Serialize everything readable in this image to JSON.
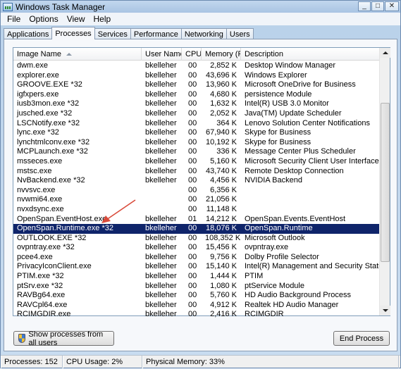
{
  "window": {
    "title": "Windows Task Manager",
    "controls": {
      "minimize": "_",
      "maximize": "□",
      "close": "✕"
    }
  },
  "menu": [
    "File",
    "Options",
    "View",
    "Help"
  ],
  "tabs": [
    "Applications",
    "Processes",
    "Services",
    "Performance",
    "Networking",
    "Users"
  ],
  "active_tab": "Processes",
  "columns": [
    "Image Name",
    "User Name",
    "CPU",
    "Memory (P...",
    "Description"
  ],
  "sort": {
    "column": "Image Name",
    "direction": "ascending"
  },
  "processes": [
    [
      "dwm.exe",
      "bkelleher",
      "00",
      "2,852 K",
      "Desktop Window Manager"
    ],
    [
      "explorer.exe",
      "bkelleher",
      "00",
      "43,696 K",
      "Windows Explorer"
    ],
    [
      "GROOVE.EXE *32",
      "bkelleher",
      "00",
      "13,960 K",
      "Microsoft OneDrive for Business"
    ],
    [
      "igfxpers.exe",
      "bkelleher",
      "00",
      "4,680 K",
      "persistence Module"
    ],
    [
      "iusb3mon.exe *32",
      "bkelleher",
      "00",
      "1,632 K",
      "Intel(R) USB 3.0 Monitor"
    ],
    [
      "jusched.exe *32",
      "bkelleher",
      "00",
      "2,052 K",
      "Java(TM) Update Scheduler"
    ],
    [
      "LSCNotify.exe *32",
      "bkelleher",
      "00",
      "364 K",
      "Lenovo Solution Center Notifications"
    ],
    [
      "lync.exe *32",
      "bkelleher",
      "00",
      "67,940 K",
      "Skype for Business"
    ],
    [
      "lynchtmlconv.exe *32",
      "bkelleher",
      "00",
      "10,192 K",
      "Skype for Business"
    ],
    [
      "MCPLaunch.exe *32",
      "bkelleher",
      "00",
      "336 K",
      "Message Center Plus Scheduler"
    ],
    [
      "msseces.exe",
      "bkelleher",
      "00",
      "5,160 K",
      "Microsoft Security Client User Interface"
    ],
    [
      "mstsc.exe",
      "bkelleher",
      "00",
      "43,740 K",
      "Remote Desktop Connection"
    ],
    [
      "NvBackend.exe *32",
      "bkelleher",
      "00",
      "4,456 K",
      "NVIDIA Backend"
    ],
    [
      "nvvsvc.exe",
      "",
      "00",
      "6,356 K",
      ""
    ],
    [
      "nvwmi64.exe",
      "",
      "00",
      "21,056 K",
      ""
    ],
    [
      "nvxdsync.exe",
      "",
      "00",
      "11,148 K",
      ""
    ],
    [
      "OpenSpan.EventHost.exe",
      "bkelleher",
      "01",
      "14,212 K",
      "OpenSpan.Events.EventHost"
    ],
    [
      "OpenSpan.Runtime.exe *32",
      "bkelleher",
      "00",
      "18,076 K",
      "OpenSpan.Runtime"
    ],
    [
      "OUTLOOK.EXE *32",
      "bkelleher",
      "00",
      "108,352 K",
      "Microsoft Outlook"
    ],
    [
      "ovpntray.exe *32",
      "bkelleher",
      "00",
      "15,456 K",
      "ovpntray.exe"
    ],
    [
      "pcee4.exe",
      "bkelleher",
      "00",
      "9,756 K",
      "Dolby Profile Selector"
    ],
    [
      "PrivacyIconClient.exe",
      "bkelleher",
      "00",
      "15,140 K",
      "Intel(R) Management and Security Status"
    ],
    [
      "PTIM.exe *32",
      "bkelleher",
      "00",
      "1,444 K",
      "PTIM"
    ],
    [
      "ptSrv.exe *32",
      "bkelleher",
      "00",
      "1,080 K",
      "ptService Module"
    ],
    [
      "RAVBg64.exe",
      "bkelleher",
      "00",
      "5,760 K",
      "HD Audio Background Process"
    ],
    [
      "RAVCpl64.exe",
      "bkelleher",
      "00",
      "4,912 K",
      "Realtek HD Audio Manager"
    ],
    [
      "RCIMGDIR.exe",
      "bkelleher",
      "00",
      "2,416 K",
      "RCIMGDIR"
    ]
  ],
  "selected_row": 17,
  "buttons": {
    "show_all": "Show processes from all users",
    "end_process": "End Process"
  },
  "status": {
    "processes": "Processes: 152",
    "cpu": "CPU Usage: 2%",
    "memory": "Physical Memory: 33%"
  },
  "colors": {
    "selection": "#0f246a",
    "annotation_arrow": "#d94a3a"
  }
}
